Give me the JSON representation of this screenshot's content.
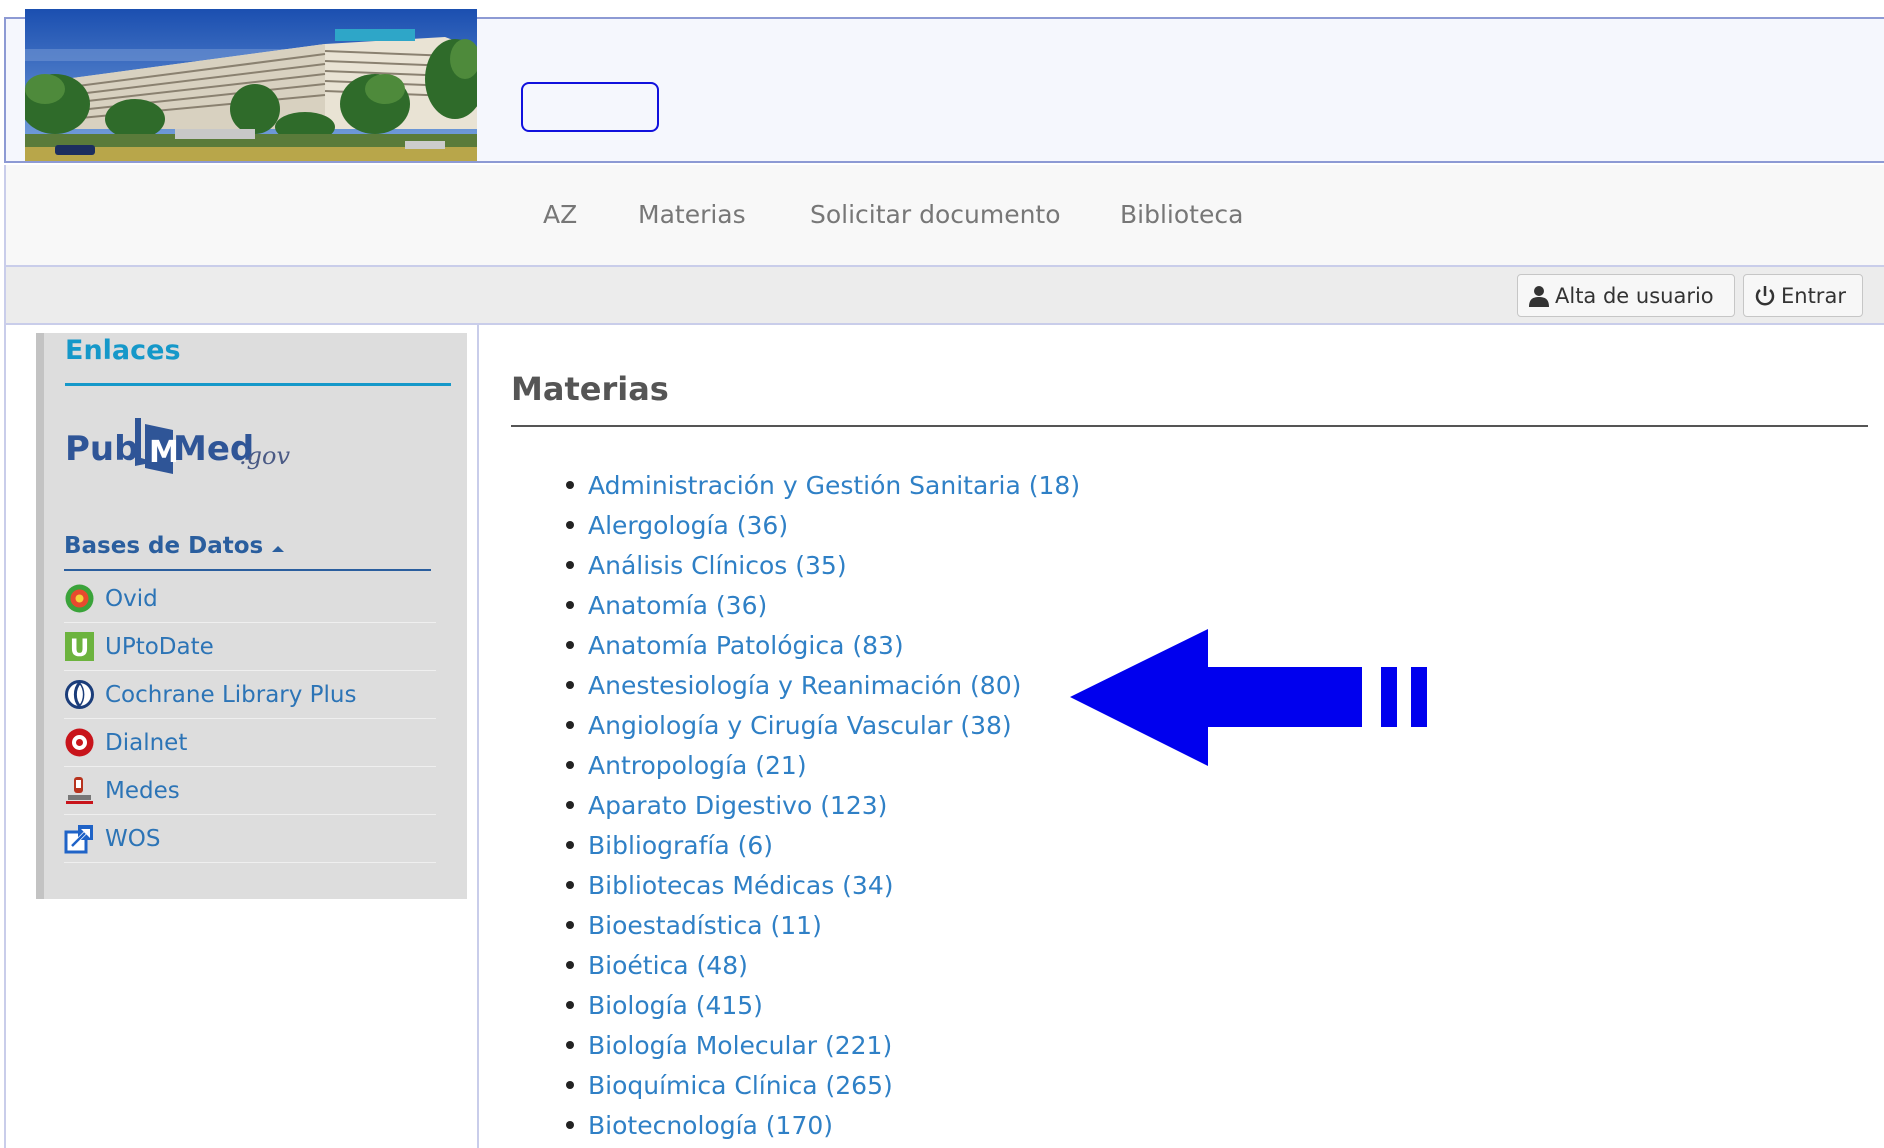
{
  "header": {
    "photo_alt": "Hospital building"
  },
  "nav": {
    "items": [
      "AZ",
      "Materias",
      "Solicitar documento",
      "Biblioteca"
    ]
  },
  "toolbar": {
    "signup_label": "Alta de usuario",
    "login_label": "Entrar"
  },
  "sidebar": {
    "title": "Enlaces",
    "pubmed": {
      "pub": "Pub",
      "med": "Med",
      "gov": ".gov"
    },
    "databases_label": "Bases de Datos",
    "databases": [
      {
        "label": "Ovid",
        "icon": "ovid-icon"
      },
      {
        "label": "UPtoDate",
        "icon": "uptodate-icon"
      },
      {
        "label": "Cochrane Library Plus",
        "icon": "cochrane-icon"
      },
      {
        "label": "Dialnet",
        "icon": "dialnet-icon"
      },
      {
        "label": "Medes",
        "icon": "medes-icon"
      },
      {
        "label": "WOS",
        "icon": "external-link-icon"
      }
    ]
  },
  "main": {
    "title": "Materias",
    "subjects": [
      "Administración y Gestión Sanitaria (18)",
      "Alergología (36)",
      "Análisis Clínicos (35)",
      "Anatomía (36)",
      "Anatomía Patológica (83)",
      "Anestesiología y Reanimación (80)",
      "Angiología y Cirugía Vascular (38)",
      "Antropología (21)",
      "Aparato Digestivo (123)",
      "Bibliografía (6)",
      "Bibliotecas Médicas (34)",
      "Bioestadística (11)",
      "Bioética (48)",
      "Biología (415)",
      "Biología Molecular (221)",
      "Bioquímica Clínica (265)",
      "Biotecnología (170)"
    ]
  },
  "colors": {
    "link": "#2f80c6",
    "sidebar_title": "#1598c9",
    "arrow": "#0000ee",
    "header_border": "#8d9ad4"
  }
}
